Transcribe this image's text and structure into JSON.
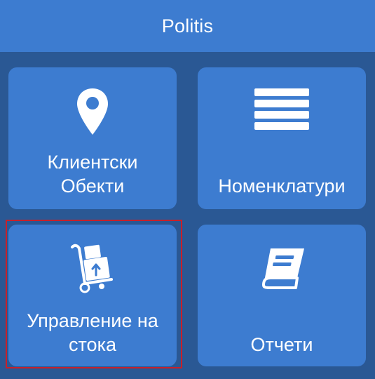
{
  "app": {
    "title": "Politis"
  },
  "tiles": [
    {
      "id": "clients",
      "label_line1": "Клиентски",
      "label_line2": "Обекти",
      "icon": "map-pin-icon"
    },
    {
      "id": "nomenclatures",
      "label_line1": "Номенклатури",
      "icon": "menu-lines-icon"
    },
    {
      "id": "stock",
      "label_line1": "Управление на",
      "label_line2": "стока",
      "icon": "hand-truck-boxes-icon",
      "selected": true
    },
    {
      "id": "reports",
      "label_line1": "Отчети",
      "icon": "book-icon"
    }
  ],
  "colors": {
    "background": "#2a5894",
    "appbar": "#3d7cd0",
    "tile": "#3d7cd0",
    "text": "#ffffff",
    "selection_border": "#c8202a"
  }
}
